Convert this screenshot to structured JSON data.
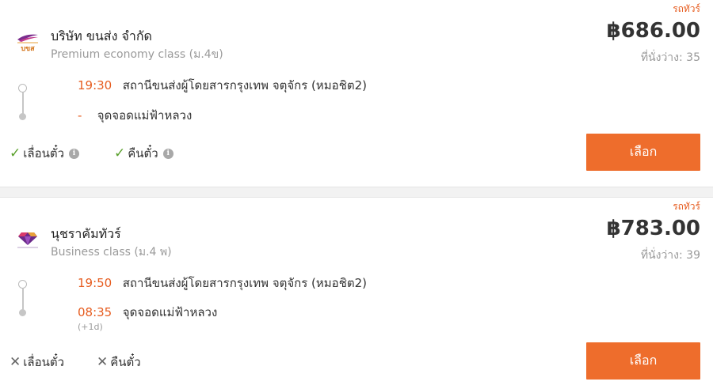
{
  "results": [
    {
      "badge": "รถทัวร์",
      "operator": "บริษัท ขนส่ง จำกัด",
      "bus_class": "Premium economy class (ม.4ข)",
      "logo_icon": "bks-logo",
      "logo_text": "บขส",
      "price": "฿686.00",
      "seats": "ที่นั่งว่าง: 35",
      "departure": {
        "time": "19:30",
        "place": "สถานีขนส่งผู้โดยสารกรุงเทพ จตุจักร (หมอชิต2)"
      },
      "arrival": {
        "time": "-",
        "place": "จุดจอดแม่ฟ้าหลวง",
        "day_offset": ""
      },
      "policies": [
        {
          "label": "เลื่อนตั๋ว",
          "allowed": true,
          "icon": "check-icon"
        },
        {
          "label": "คืนตั๋ว",
          "allowed": true,
          "icon": "check-icon"
        }
      ],
      "select_label": "เลือก"
    },
    {
      "badge": "รถทัวร์",
      "operator": "นุชราคัมทัวร์",
      "bus_class": "Business class (ม.4 พ)",
      "logo_icon": "diamond-logo",
      "price": "฿783.00",
      "seats": "ที่นั่งว่าง: 39",
      "departure": {
        "time": "19:50",
        "place": "สถานีขนส่งผู้โดยสารกรุงเทพ จตุจักร (หมอชิต2)"
      },
      "arrival": {
        "time": "08:35",
        "place": "จุดจอดแม่ฟ้าหลวง",
        "day_offset": "(+1d)"
      },
      "policies": [
        {
          "label": "เลื่อนตั๋ว",
          "allowed": false,
          "icon": "cross-icon"
        },
        {
          "label": "คืนตั๋ว",
          "allowed": false,
          "icon": "cross-icon"
        }
      ],
      "select_label": "เลือก"
    }
  ],
  "colors": {
    "accent": "#ee6d2c",
    "time": "#e65c1f",
    "check": "#5aa02c",
    "muted": "#9a9a9a"
  }
}
